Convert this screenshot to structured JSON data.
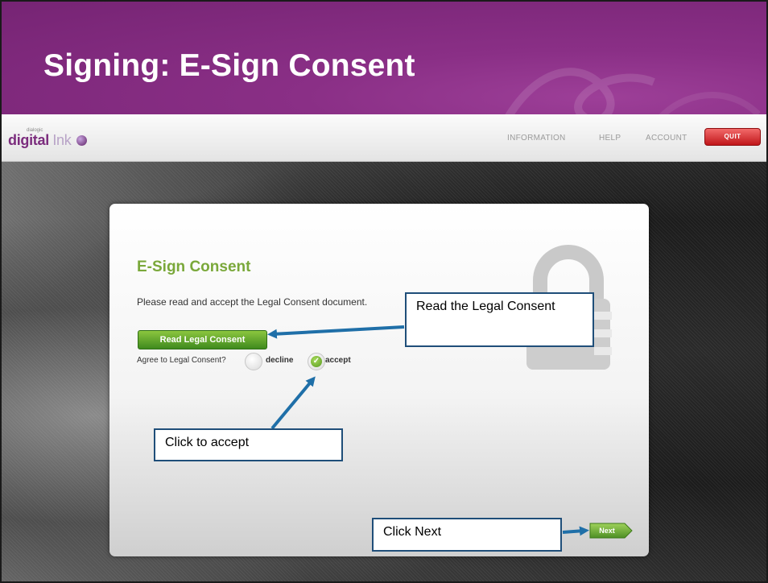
{
  "slide": {
    "title": "Signing: E-Sign Consent"
  },
  "app_header": {
    "logo_small": "dialogic",
    "logo_digital": "digital",
    "logo_ink": "Ink",
    "nav": [
      "INFORMATION",
      "HELP",
      "ACCOUNT"
    ],
    "quit_label": "QUIT",
    "quit_color": "#c0161a"
  },
  "panel": {
    "title": "E-Sign Consent",
    "instructions": "Please read and accept the Legal Consent document.",
    "read_button": "Read Legal Consent",
    "agree_label": "Agree to Legal Consent?",
    "options": [
      "decline",
      "accept"
    ],
    "selected_option": "accept",
    "next_label": "Next",
    "accent_color": "#7aa83a"
  },
  "callouts": {
    "read": "Read the Legal Consent",
    "accept": "Click to accept",
    "next": "Click Next"
  },
  "icons": [
    "lock-icon",
    "checkmark-icon",
    "globe-icon"
  ]
}
